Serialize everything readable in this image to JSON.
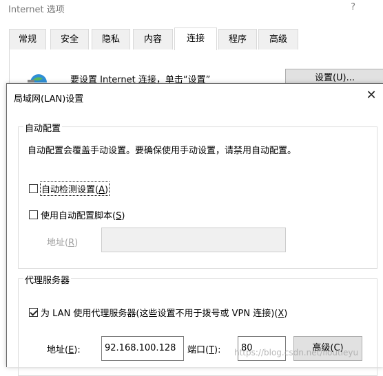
{
  "bg_window": {
    "title": "Internet 选项",
    "help": "?",
    "tabs": [
      "常规",
      "安全",
      "隐私",
      "内容",
      "连接",
      "程序",
      "高级"
    ],
    "active_tab": "连接",
    "setup_text": "要设置 Internet 连接，单击“设置”",
    "setup_button": "设置(U)..."
  },
  "dialog": {
    "title": "局域网(LAN)设置",
    "close": "✕",
    "auto_config": {
      "legend": "自动配置",
      "description": "自动配置会覆盖手动设置。要确保使用手动设置，请禁用自动配置。",
      "auto_detect": {
        "label": "自动检测设置(",
        "key": "A",
        "suffix": ")",
        "checked": false
      },
      "use_script": {
        "label": "使用自动配置脚本(",
        "key": "S",
        "suffix": ")",
        "checked": false
      },
      "address_label": "地址(",
      "address_key": "R",
      "address_suffix": ")",
      "address_value": ""
    },
    "proxy": {
      "legend": "代理服务器",
      "use_proxy": {
        "label": "为 LAN 使用代理服务器(这些设置不用于拨号或 VPN 连接)(",
        "key": "X",
        "suffix": ")",
        "checked": true
      },
      "address_label": "地址(",
      "address_key": "E",
      "address_suffix": "):",
      "address_value": "92.168.100.128",
      "port_label": "端口(",
      "port_key": "T",
      "port_suffix": "):",
      "port_value": "80",
      "advanced_button": "高级(C)"
    }
  },
  "watermark": "https://blog.csdn.net/lloutieyu"
}
